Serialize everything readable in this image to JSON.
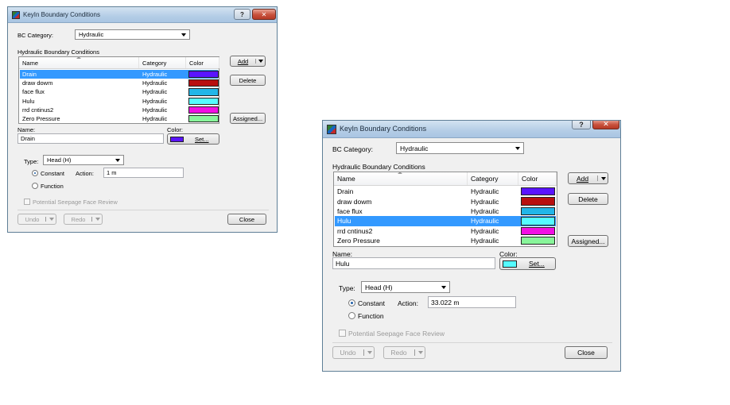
{
  "dialog_small": {
    "title": "KeyIn Boundary Conditions",
    "help_glyph": "?",
    "close_glyph": "✕",
    "bc_category_label": "BC Category:",
    "bc_category_value": "Hydraulic",
    "group_label": "Hydraulic Boundary Conditions",
    "columns": [
      "Name",
      "Category",
      "Color"
    ],
    "rows": [
      {
        "name": "Drain",
        "category": "Hydraulic",
        "color": "#5a14ff",
        "selected": true
      },
      {
        "name": "draw dowm",
        "category": "Hydraulic",
        "color": "#b80f0f",
        "selected": false
      },
      {
        "name": "face flux",
        "category": "Hydraulic",
        "color": "#22b6e8",
        "selected": false
      },
      {
        "name": "Hulu",
        "category": "Hydraulic",
        "color": "#55fbff",
        "selected": false
      },
      {
        "name": "rrd cntinus2",
        "category": "Hydraulic",
        "color": "#f20fe3",
        "selected": false
      },
      {
        "name": "Zero Pressure",
        "category": "Hydraulic",
        "color": "#88f59a",
        "selected": false
      }
    ],
    "add_label": "Add",
    "delete_label": "Delete",
    "assigned_label": "Assigned...",
    "name_label": "Name:",
    "name_value": "Drain",
    "color_label": "Color:",
    "color_value": "#5a14ff",
    "set_label": "Set...",
    "type_label": "Type:",
    "type_value": "Head (H)",
    "constant_label": "Constant",
    "function_label": "Function",
    "action_label": "Action:",
    "action_value": "1 m",
    "seepage_label": "Potential Seepage Face Review",
    "undo_label": "Undo",
    "redo_label": "Redo",
    "close_label": "Close"
  },
  "dialog_large": {
    "title": "KeyIn Boundary Conditions",
    "help_glyph": "?",
    "close_glyph": "✕",
    "bc_category_label": "BC Category:",
    "bc_category_value": "Hydraulic",
    "group_label": "Hydraulic Boundary Conditions",
    "columns": [
      "Name",
      "Category",
      "Color"
    ],
    "rows": [
      {
        "name": "Drain",
        "category": "Hydraulic",
        "color": "#5a14ff",
        "selected": false
      },
      {
        "name": "draw dowm",
        "category": "Hydraulic",
        "color": "#b80f0f",
        "selected": false
      },
      {
        "name": "face flux",
        "category": "Hydraulic",
        "color": "#22b6e8",
        "selected": false
      },
      {
        "name": "Hulu",
        "category": "Hydraulic",
        "color": "#55fbff",
        "selected": true
      },
      {
        "name": "rrd cntinus2",
        "category": "Hydraulic",
        "color": "#f20fe3",
        "selected": false
      },
      {
        "name": "Zero Pressure",
        "category": "Hydraulic",
        "color": "#88f59a",
        "selected": false
      }
    ],
    "add_label": "Add",
    "delete_label": "Delete",
    "assigned_label": "Assigned...",
    "name_label": "Name:",
    "name_value": "Hulu",
    "color_label": "Color:",
    "color_value": "#55fbff",
    "set_label": "Set...",
    "type_label": "Type:",
    "type_value": "Head (H)",
    "constant_label": "Constant",
    "function_label": "Function",
    "action_label": "Action:",
    "action_value": "33.022 m",
    "seepage_label": "Potential Seepage Face Review",
    "undo_label": "Undo",
    "redo_label": "Redo",
    "close_label": "Close"
  }
}
